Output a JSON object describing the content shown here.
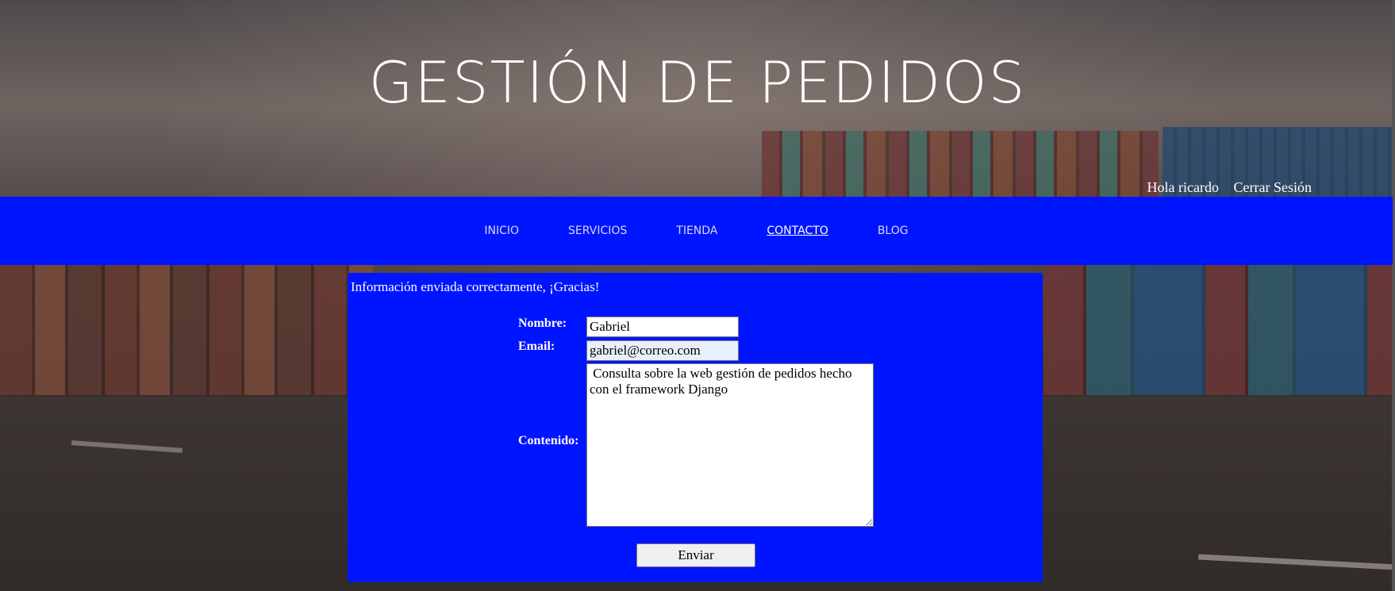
{
  "header": {
    "title": "GESTIÓN DE PEDIDOS",
    "greeting": "Hola ricardo",
    "logout_label": "Cerrar Sesión"
  },
  "nav": {
    "items": [
      {
        "label": "INICIO",
        "active": false
      },
      {
        "label": "SERVICIOS",
        "active": false
      },
      {
        "label": "TIENDA",
        "active": false
      },
      {
        "label": "CONTACTO",
        "active": true
      },
      {
        "label": "BLOG",
        "active": false
      }
    ]
  },
  "contact": {
    "success_message": "Información enviada correctamente, ¡Gracias!",
    "nombre_label": "Nombre:",
    "nombre_value": "Gabriel",
    "email_label": "Email:",
    "email_value": "gabriel@correo.com",
    "contenido_label": "Contenido:",
    "contenido_value": " Consulta sobre la web gestión de pedidos hecho con el framework Django",
    "submit_label": "Enviar"
  },
  "colors": {
    "accent": "#0015ff",
    "text": "#ffffff"
  }
}
